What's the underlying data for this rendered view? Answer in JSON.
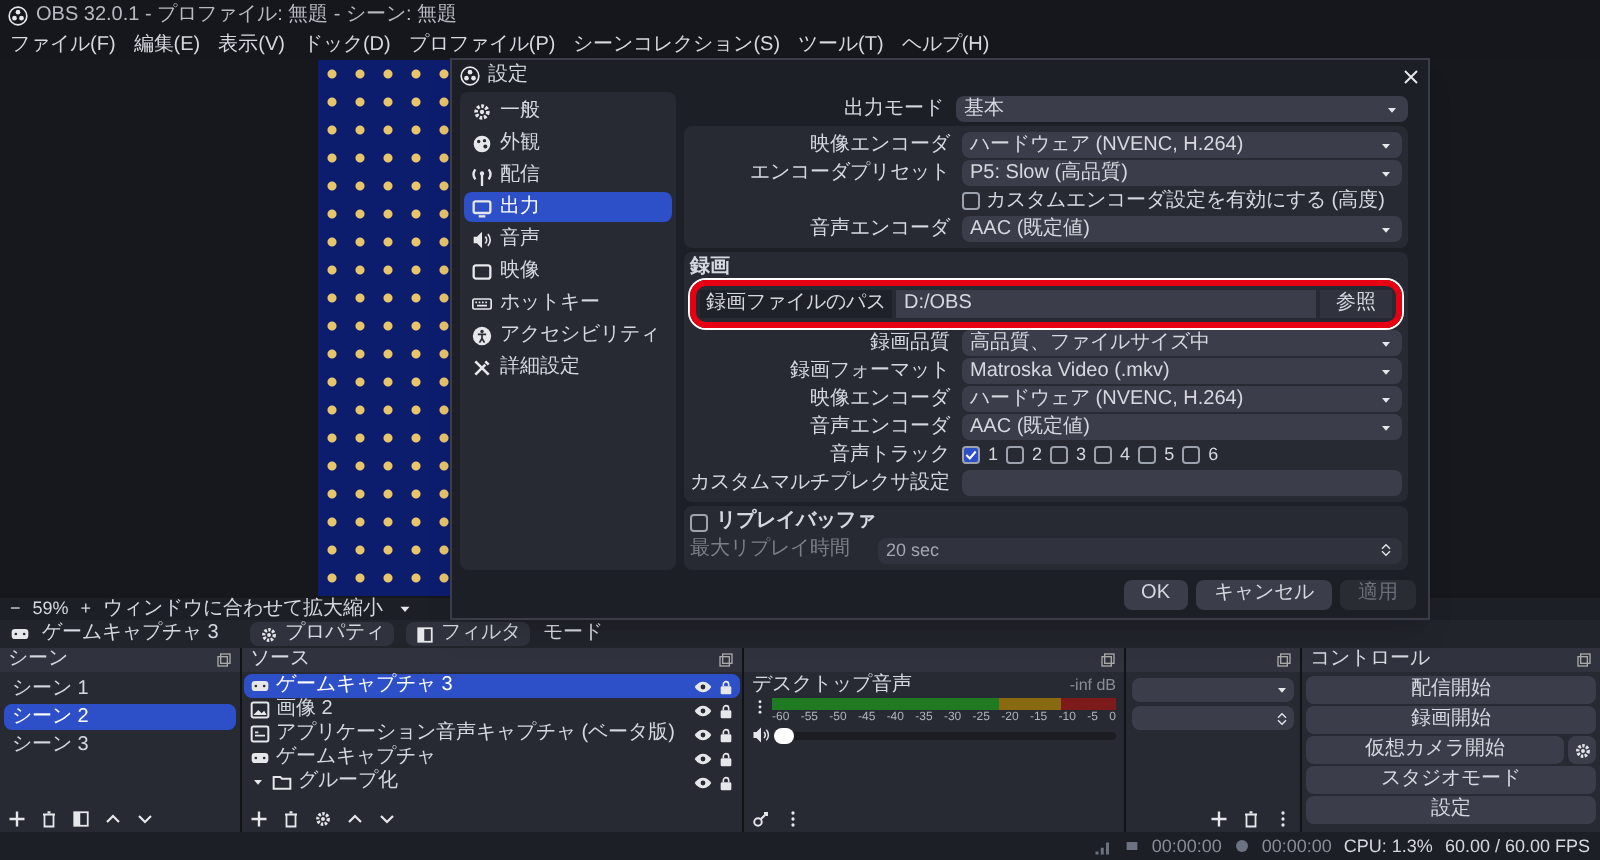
{
  "window": {
    "title": "OBS 32.0.1 - プロファイル: 無題 - シーン: 無題"
  },
  "menu": [
    "ファイル(F)",
    "編集(E)",
    "表示(V)",
    "ドック(D)",
    "プロファイル(P)",
    "シーンコレクション(S)",
    "ツール(T)",
    "ヘルプ(H)"
  ],
  "zoom_bar": {
    "minus": "−",
    "zoom": "59%",
    "plus": "+",
    "fit": "ウィンドウに合わせて拡大縮小"
  },
  "source_toolbar": {
    "source": "ゲームキャプチャ 3",
    "buttons": [
      "プロパティ",
      "フィルタ"
    ],
    "mode_label": "モード"
  },
  "scenes": {
    "title": "シーン",
    "items": [
      {
        "label": "シーン 1",
        "selected": false
      },
      {
        "label": "シーン 2",
        "selected": true
      },
      {
        "label": "シーン 3",
        "selected": false
      }
    ]
  },
  "sources": {
    "title": "ソース",
    "items": [
      {
        "label": "ゲームキャプチャ 3",
        "kind": "game",
        "selected": true
      },
      {
        "label": "画像 2",
        "kind": "image",
        "selected": false
      },
      {
        "label": "アプリケーション音声キャプチャ (ベータ版)",
        "kind": "app",
        "selected": false
      },
      {
        "label": "ゲームキャプチャ",
        "kind": "game",
        "selected": false
      },
      {
        "label": "グループ化",
        "kind": "group",
        "selected": false,
        "expanded": true
      }
    ]
  },
  "mixer": {
    "channels": [
      {
        "name": "デスクトップ音声",
        "reading": "-inf dB",
        "level": 0,
        "ticks": [
          "-60",
          "-55",
          "-50",
          "-45",
          "-40",
          "-35",
          "-30",
          "-25",
          "-20",
          "-15",
          "-10",
          "-5",
          "0"
        ]
      }
    ]
  },
  "controls": {
    "title": "コントロール",
    "buttons": [
      "配信開始",
      "録画開始",
      "仮想カメラ開始",
      "スタジオモード",
      "設定"
    ]
  },
  "status_bar": {
    "rec_time": "00:00:00",
    "stream_time": "00:00:00",
    "cpu": "CPU: 1.3%",
    "fps": "60.00 / 60.00 FPS"
  },
  "dialog": {
    "title": "設定",
    "nav": [
      {
        "label": "一般",
        "selected": false
      },
      {
        "label": "外観",
        "selected": false
      },
      {
        "label": "配信",
        "selected": false
      },
      {
        "label": "出力",
        "selected": true
      },
      {
        "label": "音声",
        "selected": false
      },
      {
        "label": "映像",
        "selected": false
      },
      {
        "label": "ホットキー",
        "selected": false
      },
      {
        "label": "アクセシビリティ",
        "selected": false
      },
      {
        "label": "詳細設定",
        "selected": false
      }
    ],
    "output_mode": {
      "label": "出力モード",
      "value": "基本"
    },
    "streaming_rows": [
      {
        "kind": "select",
        "label": "映像エンコーダ",
        "value": "ハードウェア (NVENC, H.264)"
      },
      {
        "kind": "select",
        "label": "エンコーダプリセット",
        "value": "P5: Slow (高品質)"
      },
      {
        "kind": "checkbox",
        "label": "カスタムエンコーダ設定を有効にする (高度)",
        "checked": false
      },
      {
        "kind": "select",
        "label": "音声エンコーダ",
        "value": "AAC (既定値)"
      }
    ],
    "recording": {
      "title": "録画",
      "path": {
        "label": "録画ファイルのパス",
        "value": "D:/OBS",
        "button": "参照",
        "highlighted": true
      },
      "rows": [
        {
          "kind": "select",
          "label": "録画品質",
          "value": "高品質、ファイルサイズ中"
        },
        {
          "kind": "select",
          "label": "録画フォーマット",
          "value": "Matroska Video (.mkv)"
        },
        {
          "kind": "select",
          "label": "映像エンコーダ",
          "value": "ハードウェア (NVENC, H.264)"
        },
        {
          "kind": "select",
          "label": "音声エンコーダ",
          "value": "AAC (既定値)"
        },
        {
          "kind": "tracks",
          "label": "音声トラック",
          "tracks": [
            {
              "label": "1",
              "checked": true
            },
            {
              "label": "2",
              "checked": false
            },
            {
              "label": "3",
              "checked": false
            },
            {
              "label": "4",
              "checked": false
            },
            {
              "label": "5",
              "checked": false
            },
            {
              "label": "6",
              "checked": false
            }
          ]
        },
        {
          "kind": "text",
          "label": "カスタムマルチプレクサ設定",
          "value": ""
        }
      ]
    },
    "replay_buffer": {
      "label": "リプレイバッファ",
      "checked": false,
      "rows": [
        {
          "label": "最大リプレイ時間",
          "value": "20 sec",
          "disabled": true
        }
      ]
    },
    "buttons": [
      {
        "label": "OK",
        "disabled": false
      },
      {
        "label": "キャンセル",
        "disabled": false
      },
      {
        "label": "適用",
        "disabled": true
      }
    ]
  }
}
